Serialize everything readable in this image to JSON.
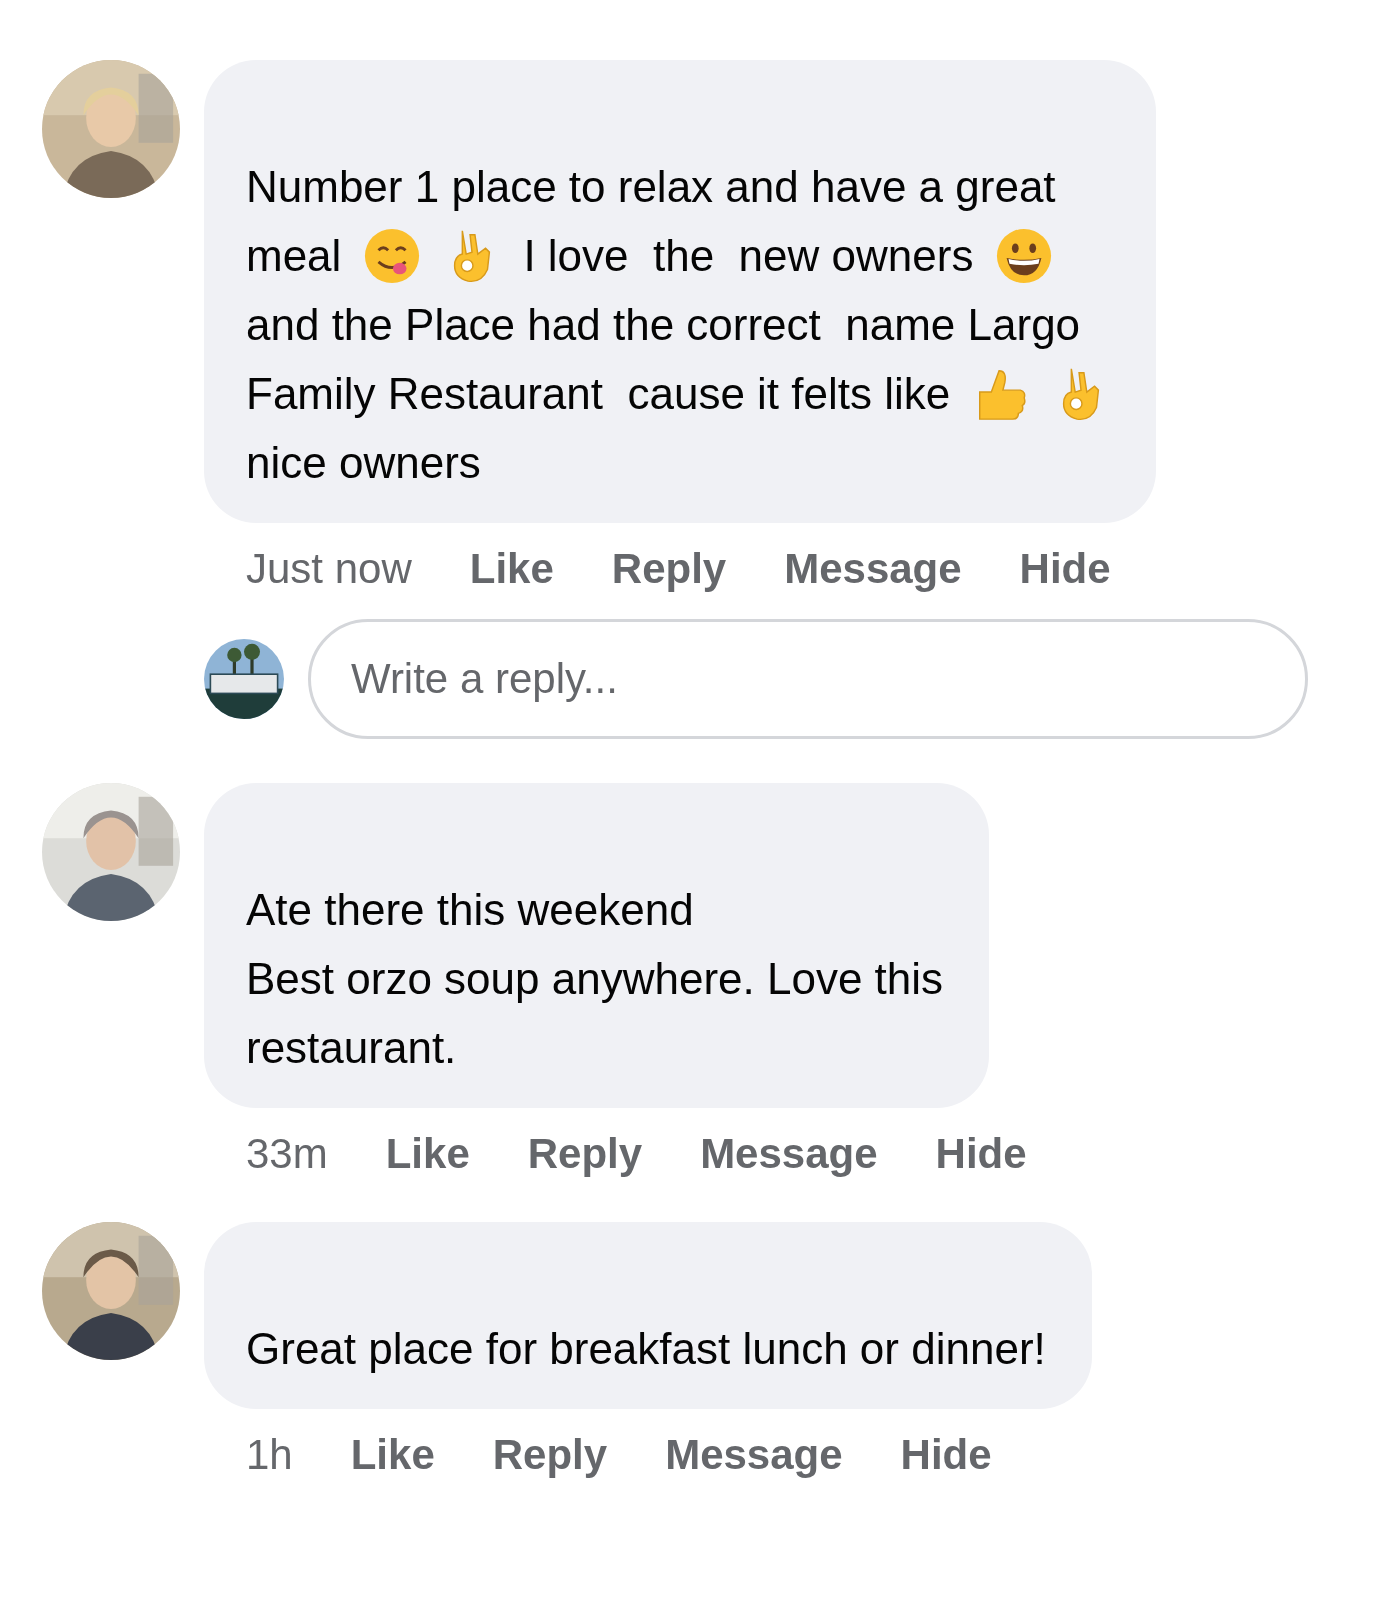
{
  "comments": [
    {
      "avatar": {
        "kind": "picture"
      },
      "lines": [
        [
          {
            "kind": "text",
            "text": "Number 1 place to relax and have a great"
          }
        ],
        [
          {
            "kind": "text",
            "text": "meal"
          },
          {
            "kind": "yum"
          },
          {
            "kind": "ok"
          },
          {
            "kind": "text",
            "text": "I love  the  new owners"
          },
          {
            "kind": "grin"
          }
        ],
        [
          {
            "kind": "text",
            "text": "and the Place had the correct  name Largo"
          }
        ],
        [
          {
            "kind": "text",
            "text": "Family Restaurant  cause it felts like"
          },
          {
            "kind": "thumb"
          },
          {
            "kind": "ok"
          }
        ],
        [
          {
            "kind": "text",
            "text": "nice owners"
          }
        ]
      ],
      "time": "Just now",
      "actions": [
        "Like",
        "Reply",
        "Message",
        "Hide"
      ],
      "reply_box": {
        "avatar": {
          "kind": "picture"
        },
        "placeholder": "Write a reply..."
      }
    },
    {
      "avatar": {
        "kind": "picture"
      },
      "lines": [
        [
          {
            "kind": "text",
            "text": "Ate there this weekend"
          }
        ],
        [
          {
            "kind": "text",
            "text": "Best orzo soup anywhere. Love this"
          }
        ],
        [
          {
            "kind": "text",
            "text": "restaurant."
          }
        ]
      ],
      "time": "33m",
      "actions": [
        "Like",
        "Reply",
        "Message",
        "Hide"
      ]
    },
    {
      "avatar": {
        "kind": "picture"
      },
      "lines": [
        [
          {
            "kind": "text",
            "text": "Great place for breakfast lunch or dinner!"
          }
        ]
      ],
      "time": "1h",
      "actions": [
        "Like",
        "Reply",
        "Message",
        "Hide"
      ]
    }
  ]
}
